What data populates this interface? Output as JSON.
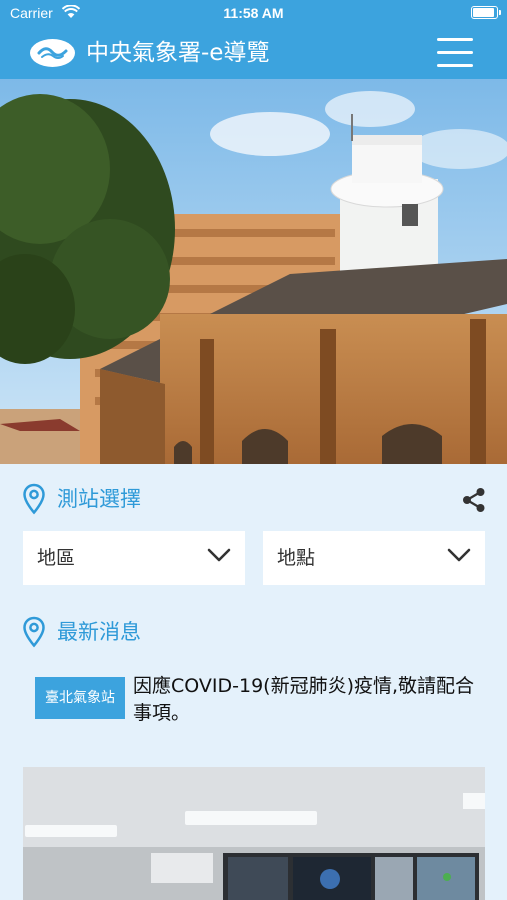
{
  "status_bar": {
    "carrier": "Carrier",
    "time": "11:58 AM",
    "battery_level": 0.95
  },
  "header": {
    "title": "中央氣象署-e導覽"
  },
  "station_section": {
    "title": "測站選擇"
  },
  "dropdowns": {
    "region": "地區",
    "location": "地點"
  },
  "news_section": {
    "title": "最新消息"
  },
  "news": [
    {
      "badge": "臺北氣象站",
      "text": "因應COVID-19(新冠肺炎)疫情,敬請配合事項。"
    }
  ],
  "icons": {
    "menu": "hamburger-menu-icon",
    "share": "share-icon",
    "location": "location-pin-icon",
    "dropdown": "chevron-down-icon"
  },
  "colors": {
    "accent": "#3ca3de",
    "page_background": "#e4f1fb"
  }
}
